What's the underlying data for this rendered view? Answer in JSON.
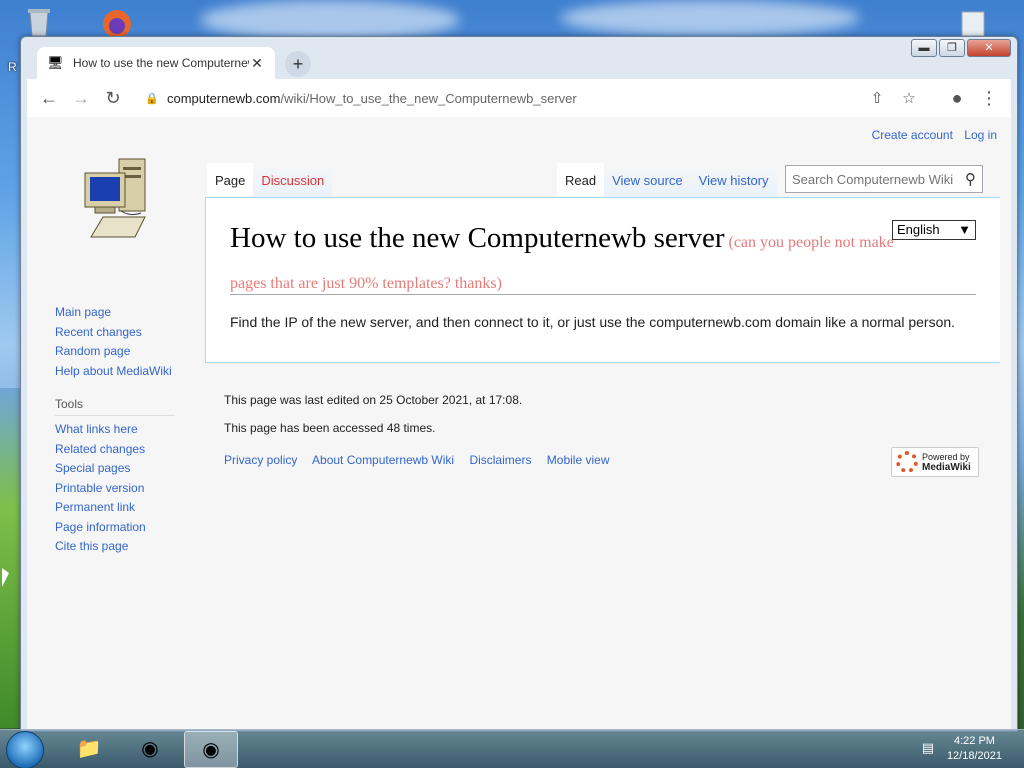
{
  "desktop": {
    "recycle_bin_icon": "recycle-bin-icon",
    "firefox_icon": "firefox-icon",
    "partial_label": "R"
  },
  "browser": {
    "tab": {
      "title": "How to use the new Computernewb server",
      "favicon": "wiki-favicon"
    },
    "url_domain": "computernewb.com",
    "url_path": "/wiki/How_to_use_the_new_Computernewb_server"
  },
  "page": {
    "personal_links": [
      "Create account",
      "Log in"
    ],
    "namespace_tabs": [
      "Page",
      "Discussion"
    ],
    "view_tabs": [
      "Read",
      "View source",
      "View history"
    ],
    "search_placeholder": "Search Computernewb Wiki",
    "navigation": [
      "Main page",
      "Recent changes",
      "Random page",
      "Help about MediaWiki"
    ],
    "tools_heading": "Tools",
    "tools": [
      "What links here",
      "Related changes",
      "Special pages",
      "Printable version",
      "Permanent link",
      "Page information",
      "Cite this page"
    ],
    "language_selected": "English",
    "title": "How to use the new Computernewb server",
    "title_note": "(can you people not make pages that are just 90% templates? thanks)",
    "body": "Find the IP of the new server, and then connect to it, or just use the computernewb.com domain like a normal person.",
    "last_edited": "This page was last edited on 25 October 2021, at 17:08.",
    "access_count": "This page has been accessed 48 times.",
    "footer_links": [
      "Privacy policy",
      "About Computernewb Wiki",
      "Disclaimers",
      "Mobile view"
    ],
    "powered_by": {
      "line1": "Powered by",
      "line2": "MediaWiki"
    }
  },
  "taskbar": {
    "time": "4:22 PM",
    "date": "12/18/2021"
  }
}
